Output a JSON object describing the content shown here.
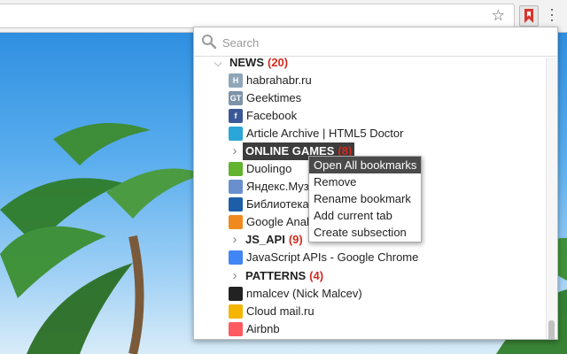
{
  "search": {
    "placeholder": "Search"
  },
  "tree": [
    {
      "kind": "folder",
      "name": "NEWS",
      "count": "(20)",
      "expanded": true
    },
    {
      "kind": "bookmark",
      "title": "habrahabr.ru",
      "icon": "habr-icon",
      "icon_text": "H",
      "color": "#8fa6b8"
    },
    {
      "kind": "bookmark",
      "title": "Geektimes",
      "icon": "geektimes-icon",
      "icon_text": "GT",
      "color": "#7d93a8"
    },
    {
      "kind": "bookmark",
      "title": "Facebook",
      "icon": "facebook-icon",
      "icon_text": "f",
      "color": "#3b5998"
    },
    {
      "kind": "bookmark",
      "title": "Article Archive | HTML5 Doctor",
      "icon": "html5doctor-icon",
      "icon_text": "",
      "color": "#2aa7d6"
    },
    {
      "kind": "folder",
      "name": "ONLINE GAMES",
      "count": "(8)",
      "expanded": false,
      "highlighted": true
    },
    {
      "kind": "bookmark",
      "title": "Duolingo",
      "icon": "duolingo-icon",
      "icon_text": "",
      "color": "#62b32f"
    },
    {
      "kind": "bookmark",
      "title": "Яндекс.Музыка",
      "icon": "speaker-icon",
      "icon_text": "",
      "color": "#6a8fcf"
    },
    {
      "kind": "bookmark",
      "title": "Библиотека",
      "icon": "library-icon",
      "icon_text": "",
      "color": "#1c5fa8"
    },
    {
      "kind": "bookmark",
      "title": "Google Analytics",
      "icon": "analytics-icon",
      "icon_text": "",
      "color": "#f08a1e"
    },
    {
      "kind": "folder",
      "name": "JS_API",
      "count": "(9)",
      "expanded": false
    },
    {
      "kind": "bookmark",
      "title": "JavaScript APIs - Google Chrome",
      "icon": "chrome-icon",
      "icon_text": "",
      "color": "#4285f4"
    },
    {
      "kind": "folder",
      "name": "PATTERNS",
      "count": "(4)",
      "expanded": false
    },
    {
      "kind": "bookmark",
      "title": "nmalcev (Nick Malcev)",
      "icon": "github-icon",
      "icon_text": "",
      "color": "#222222"
    },
    {
      "kind": "bookmark",
      "title": "Cloud mail.ru",
      "icon": "cloud-icon",
      "icon_text": "",
      "color": "#f5b400"
    },
    {
      "kind": "bookmark",
      "title": "Airbnb",
      "icon": "airbnb-icon",
      "icon_text": "",
      "color": "#ff5a5f"
    }
  ],
  "context_menu": {
    "items": [
      "Open All bookmarks",
      "Remove",
      "Rename bookmark",
      "Add current tab",
      "Create subsection"
    ],
    "active_index": 0
  },
  "colors": {
    "accent_count": "#d32a1e",
    "extension_red": "#d9342b"
  }
}
